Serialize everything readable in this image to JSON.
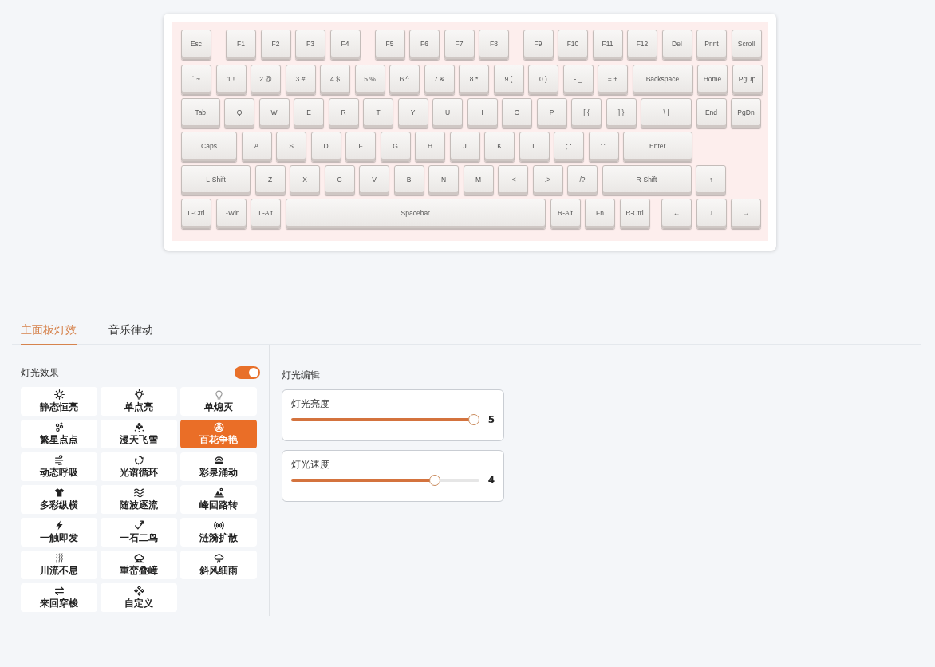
{
  "keyboard": {
    "rows": [
      {
        "keys": [
          "Esc",
          "F1",
          "F2",
          "F3",
          "F4",
          "F5",
          "F6",
          "F7",
          "F8",
          "F9",
          "F10",
          "F11",
          "F12",
          "Del",
          "Print",
          "Scroll"
        ]
      },
      {
        "keys": [
          "` ~",
          "1 !",
          "2 @",
          "3 #",
          "4 $",
          "5 %",
          "6 ^",
          "7 &",
          "8 *",
          "9 (",
          "0 )",
          "- _",
          "= +",
          "Backspace",
          "Home",
          "PgUp"
        ]
      },
      {
        "keys": [
          "Tab",
          "Q",
          "W",
          "E",
          "R",
          "T",
          "Y",
          "U",
          "I",
          "O",
          "P",
          "[ {",
          "] }",
          "\\ |",
          "End",
          "PgDn"
        ]
      },
      {
        "keys": [
          "Caps",
          "A",
          "S",
          "D",
          "F",
          "G",
          "H",
          "J",
          "K",
          "L",
          "; :",
          "' \"",
          "Enter"
        ]
      },
      {
        "keys": [
          "L-Shift",
          "Z",
          "X",
          "C",
          "V",
          "B",
          "N",
          "M",
          ",<",
          ".>",
          "/?",
          "R-Shift",
          "↑"
        ]
      },
      {
        "keys": [
          "L-Ctrl",
          "L-Win",
          "L-Alt",
          "Spacebar",
          "R-Alt",
          "Fn",
          "R-Ctrl",
          "←",
          "↓",
          "→"
        ]
      }
    ]
  },
  "tabs": [
    {
      "label": "主面板灯效",
      "selected": true
    },
    {
      "label": "音乐律动",
      "selected": false
    }
  ],
  "effects": {
    "title": "灯光效果",
    "on": true,
    "items": [
      {
        "label": "静态恒亮",
        "selected": false
      },
      {
        "label": "单点亮",
        "selected": false
      },
      {
        "label": "单熄灭",
        "selected": false
      },
      {
        "label": "繁星点点",
        "selected": false
      },
      {
        "label": "漫天飞雪",
        "selected": false
      },
      {
        "label": "百花争艳",
        "selected": true
      },
      {
        "label": "动态呼吸",
        "selected": false
      },
      {
        "label": "光谱循环",
        "selected": false
      },
      {
        "label": "彩泉涌动",
        "selected": false
      },
      {
        "label": "多彩纵横",
        "selected": false
      },
      {
        "label": "随波逐流",
        "selected": false
      },
      {
        "label": "峰回路转",
        "selected": false
      },
      {
        "label": "一触即发",
        "selected": false
      },
      {
        "label": "一石二鸟",
        "selected": false
      },
      {
        "label": "涟漪扩散",
        "selected": false
      },
      {
        "label": "川流不息",
        "selected": false
      },
      {
        "label": "重峦叠嶂",
        "selected": false
      },
      {
        "label": "斜风细雨",
        "selected": false
      },
      {
        "label": "来回穿梭",
        "selected": false
      },
      {
        "label": "自定义",
        "selected": false
      }
    ]
  },
  "editor": {
    "title": "灯光编辑",
    "sliders": [
      {
        "label": "灯光亮度",
        "level": 1,
        "reading": "5"
      },
      {
        "label": "灯光速度",
        "level": 0.78,
        "reading": "4"
      }
    ]
  }
}
